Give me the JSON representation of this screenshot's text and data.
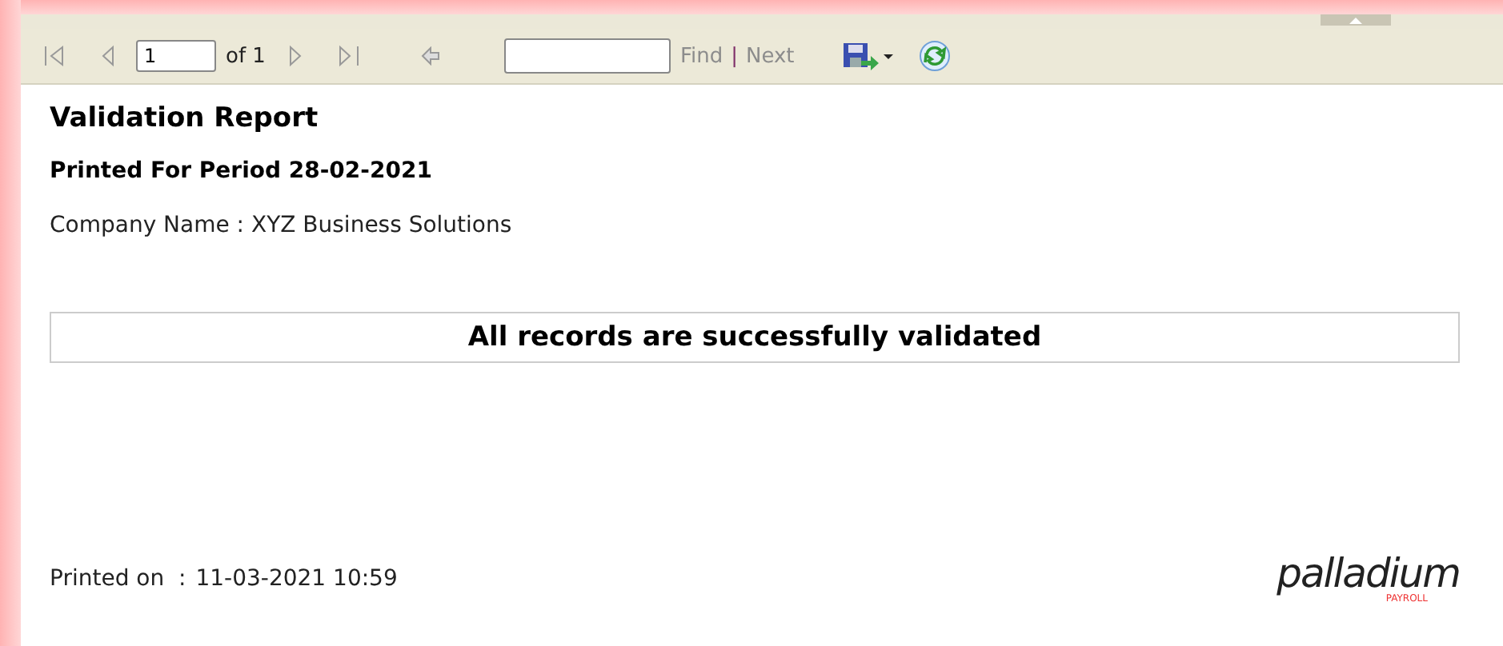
{
  "toolbar": {
    "page_number": "1",
    "page_count": "of 1",
    "find_label": "Find",
    "separator": "|",
    "next_label": "Next"
  },
  "report": {
    "title": "Validation Report",
    "period": "Printed For Period 28-02-2021",
    "company": "Company Name : XYZ Business Solutions",
    "message": "All records are successfully validated",
    "printed_label": "Printed on  :",
    "printed_value": "11-03-2021 10:59"
  },
  "logo": {
    "name": "palladium",
    "tagline": "PAYROLL"
  }
}
